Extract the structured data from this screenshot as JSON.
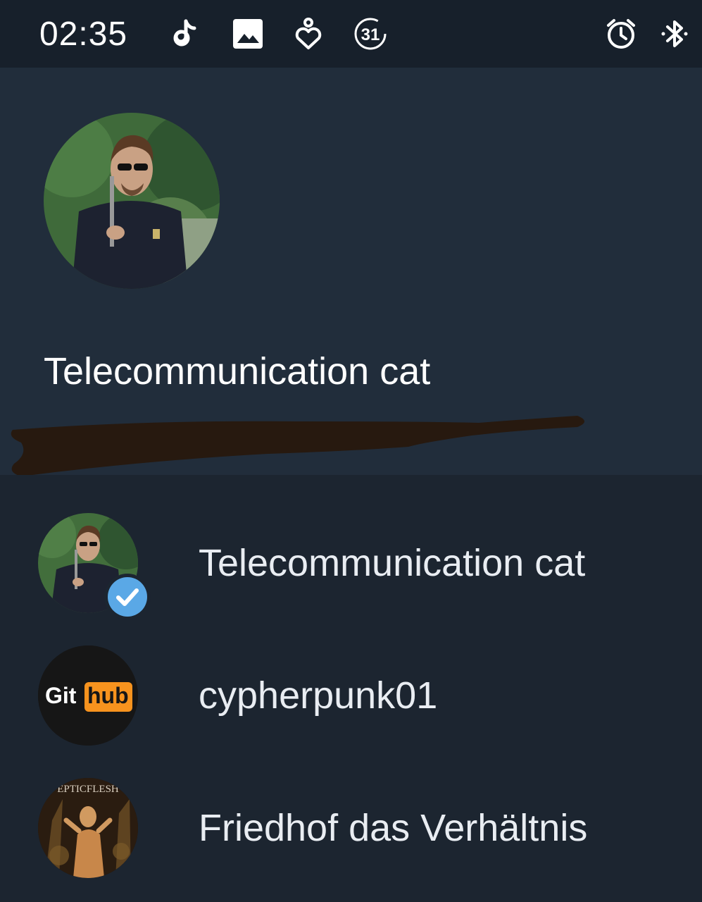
{
  "status_bar": {
    "time": "02:35",
    "notification_count": "31",
    "icons": [
      "tiktok-icon",
      "gallery-icon",
      "health-heart-icon",
      "calendar-count-icon",
      "alarm-icon",
      "bluetooth-icon"
    ]
  },
  "header": {
    "account_name": "Telecommunication cat",
    "avatar": "profile-photo"
  },
  "accounts": [
    {
      "name": "Telecommunication cat",
      "avatar": "profile-photo",
      "active": true
    },
    {
      "name": "cypherpunk01",
      "avatar": "github-logo",
      "logo_text_left": "Git",
      "logo_text_right": "hub"
    },
    {
      "name": "Friedhof das Verhältnis",
      "avatar": "album-art",
      "album_text": "EPTICFLESH"
    }
  ],
  "colors": {
    "status_bar_bg": "#17202b",
    "header_bg": "#212d3b",
    "list_bg": "#1c2530",
    "check_badge": "#5aa8e6",
    "github_orange": "#f7931e"
  }
}
